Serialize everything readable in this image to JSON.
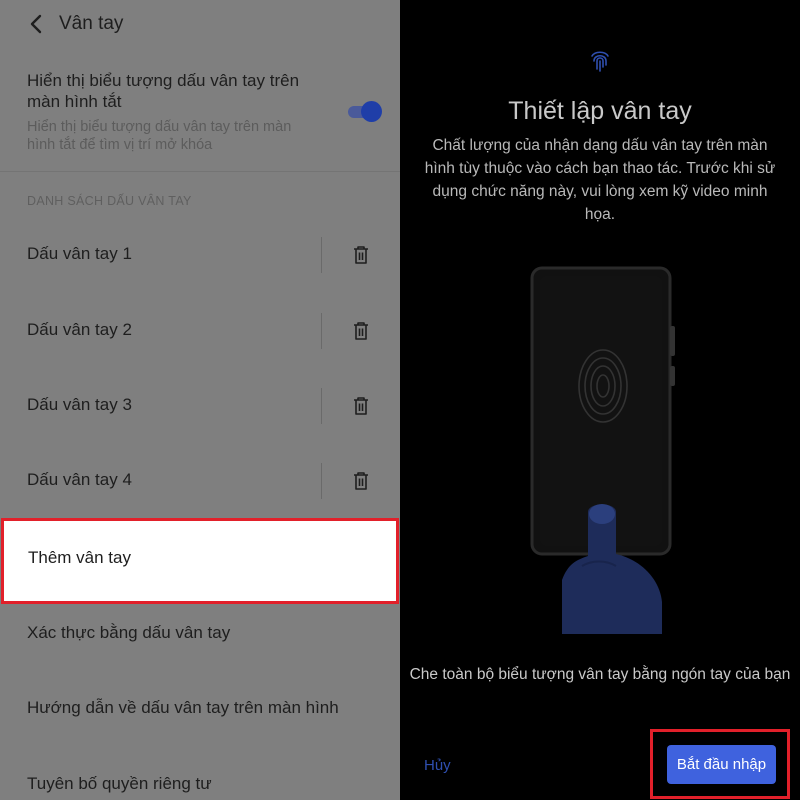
{
  "header": {
    "title": "Vân tay"
  },
  "screen_off_setting": {
    "title": "Hiển thị biểu tượng dấu vân tay trên màn hình tắt",
    "description": "Hiển thị biểu tượng dấu vân tay trên màn hình tắt để tìm vị trí mở khóa",
    "enabled": true
  },
  "fingerprint_section": {
    "header": "DANH SÁCH DẤU VÂN TAY",
    "items": [
      {
        "label": "Dấu vân tay 1"
      },
      {
        "label": "Dấu vân tay 2"
      },
      {
        "label": "Dấu vân tay 3"
      },
      {
        "label": "Dấu vân tay 4"
      }
    ],
    "add_label": "Thêm vân tay"
  },
  "menu": {
    "verify": "Xác thực bằng dấu vân tay",
    "guide": "Hướng dẫn về dấu vân tay trên màn hình",
    "privacy": "Tuyên bố quyền riêng tư"
  },
  "setup_dialog": {
    "title": "Thiết lập vân tay",
    "description": "Chất lượng của nhận dạng dấu vân tay trên màn hình tùy thuộc vào cách bạn thao tác. Trước khi sử dụng chức năng này, vui lòng xem kỹ video minh họa.",
    "hint": "Che toàn bộ biểu tượng vân tay bằng ngón tay của bạn",
    "cancel_label": "Hủy",
    "start_label": "Bắt đầu nhập"
  },
  "colors": {
    "dim_overlay": "#7f7f7f",
    "accent": "#3f62de",
    "highlight": "#e2202a",
    "toggle_on": "#1f3ea8"
  },
  "icons": [
    "back-arrow-icon",
    "trash-icon",
    "fingerprint-icon",
    "phone-illustration"
  ]
}
